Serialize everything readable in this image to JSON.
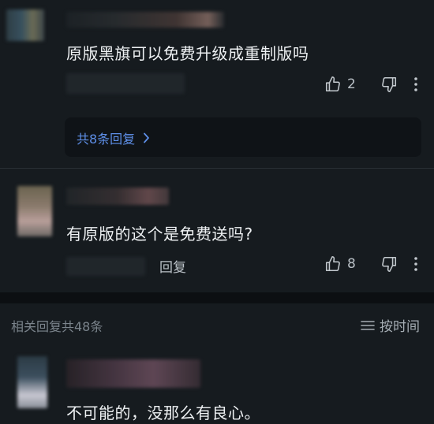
{
  "comments": [
    {
      "text": "原版黑旗可以免费升级成重制版吗",
      "likes": "2"
    },
    {
      "text": "有原版的这个是免费送吗?",
      "likes": "8",
      "reply_label": "回复"
    },
    {
      "text": "不可能的，没那么有良心。"
    }
  ],
  "reply_thread": {
    "label": "共8条回复"
  },
  "related_section": {
    "title": "相关回复共48条",
    "sort_label": "按时间"
  },
  "icons": {
    "like": "thumbs-up-icon",
    "dislike": "thumbs-down-icon",
    "more": "more-vertical-icon",
    "chevron": "chevron-right-icon",
    "sort": "menu-lines-icon"
  },
  "colors": {
    "background": "#161B1F",
    "link": "#5E8FE8"
  }
}
